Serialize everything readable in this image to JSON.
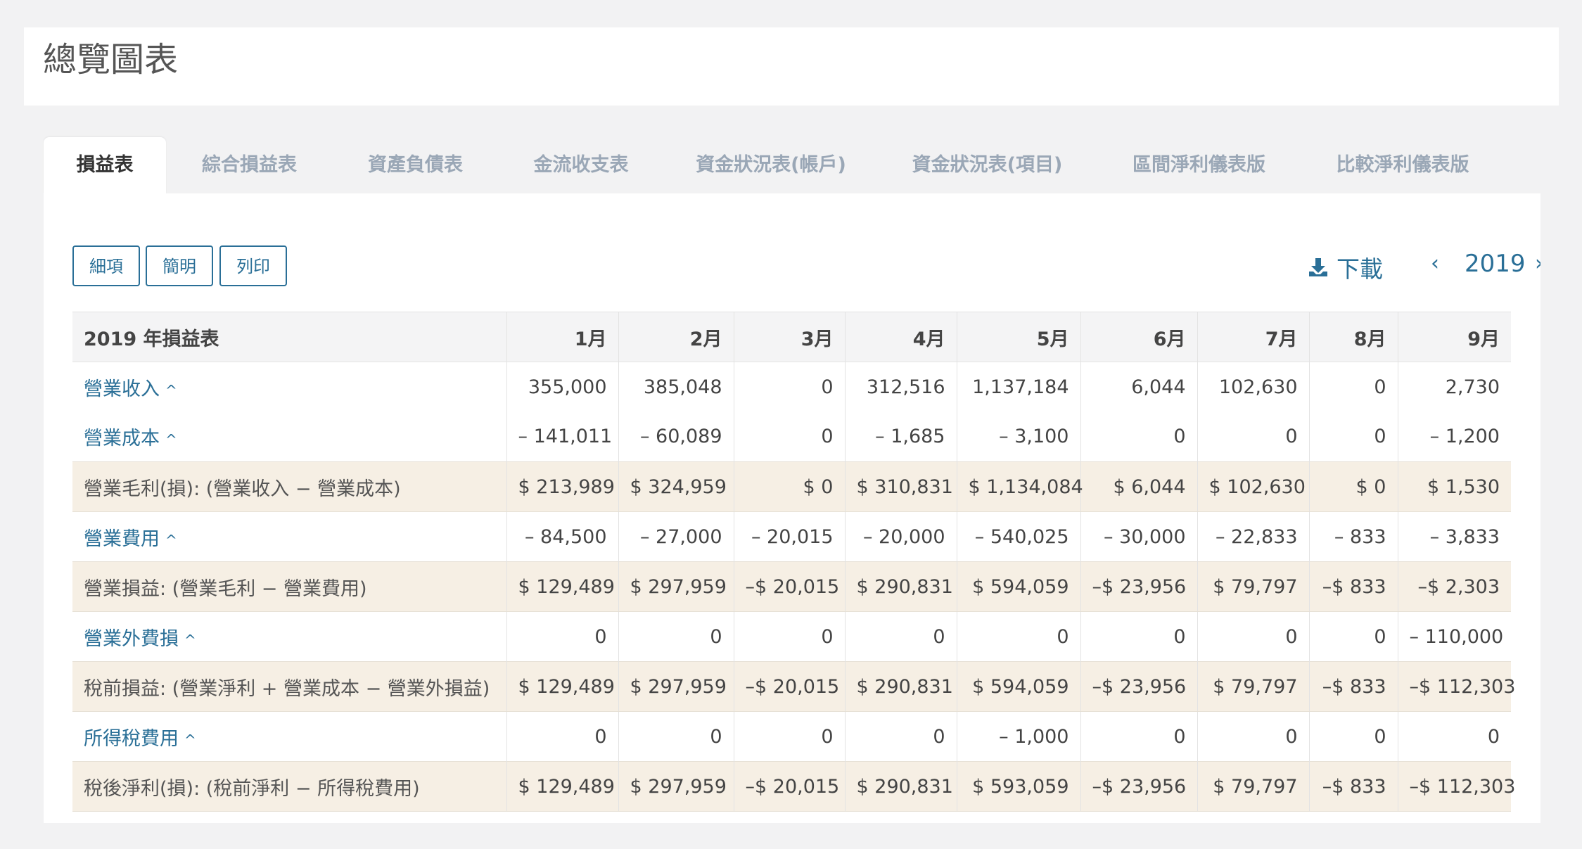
{
  "header": {
    "title": "總覽圖表"
  },
  "tabs": [
    {
      "label": "損益表",
      "active": true
    },
    {
      "label": "綜合損益表",
      "active": false
    },
    {
      "label": "資產負債表",
      "active": false
    },
    {
      "label": "金流收支表",
      "active": false
    },
    {
      "label": "資金狀況表(帳戶)",
      "active": false
    },
    {
      "label": "資金狀況表(項目)",
      "active": false
    },
    {
      "label": "區間淨利儀表版",
      "active": false
    },
    {
      "label": "比較淨利儀表版",
      "active": false
    }
  ],
  "toolbar": {
    "detail_label": "細項",
    "simple_label": "簡明",
    "print_label": "列印",
    "download_label": "下載",
    "download_icon": "download-icon",
    "year": "2019",
    "prev_glyph": "‹",
    "next_glyph": "›"
  },
  "colors": {
    "accent": "#2a6f97",
    "subtotal_bg": "#f6efe4",
    "header_bg": "#f4f4f5",
    "tab_inactive": "#9aa7b6"
  },
  "table": {
    "title": "2019 年損益表",
    "months": [
      "1月",
      "2月",
      "3月",
      "4月",
      "5月",
      "6月",
      "7月",
      "8月",
      "9月"
    ],
    "rows": [
      {
        "type": "section",
        "label": "營業收入",
        "chevron": "^",
        "values": [
          "355,000",
          "385,048",
          "0",
          "312,516",
          "1,137,184",
          "6,044",
          "102,630",
          "0",
          "2,730"
        ]
      },
      {
        "type": "section",
        "label": "營業成本",
        "chevron": "^",
        "values": [
          "– 141,011",
          "– 60,089",
          "0",
          "– 1,685",
          "– 3,100",
          "0",
          "0",
          "0",
          "– 1,200"
        ]
      },
      {
        "type": "subtotal",
        "label": "營業毛利(損): (營業收入 − 營業成本)",
        "values": [
          "$ 213,989",
          "$ 324,959",
          "$ 0",
          "$ 310,831",
          "$ 1,134,084",
          "$ 6,044",
          "$ 102,630",
          "$ 0",
          "$ 1,530"
        ]
      },
      {
        "type": "section",
        "label": "營業費用",
        "chevron": "^",
        "values": [
          "– 84,500",
          "– 27,000",
          "– 20,015",
          "– 20,000",
          "– 540,025",
          "– 30,000",
          "– 22,833",
          "– 833",
          "– 3,833"
        ]
      },
      {
        "type": "subtotal",
        "label": "營業損益: (營業毛利 − 營業費用)",
        "values": [
          "$ 129,489",
          "$ 297,959",
          "–$ 20,015",
          "$ 290,831",
          "$ 594,059",
          "–$ 23,956",
          "$ 79,797",
          "–$ 833",
          "–$ 2,303"
        ]
      },
      {
        "type": "section",
        "label": "營業外費損",
        "chevron": "^",
        "values": [
          "0",
          "0",
          "0",
          "0",
          "0",
          "0",
          "0",
          "0",
          "– 110,000"
        ]
      },
      {
        "type": "subtotal",
        "label": "稅前損益: (營業淨利 + 營業成本 − 營業外損益)",
        "values": [
          "$ 129,489",
          "$ 297,959",
          "–$ 20,015",
          "$ 290,831",
          "$ 594,059",
          "–$ 23,956",
          "$ 79,797",
          "–$ 833",
          "–$ 112,303"
        ]
      },
      {
        "type": "section",
        "label": "所得稅費用",
        "chevron": "^",
        "values": [
          "0",
          "0",
          "0",
          "0",
          "– 1,000",
          "0",
          "0",
          "0",
          "0"
        ]
      },
      {
        "type": "subtotal",
        "label": "稅後淨利(損): (稅前淨利 − 所得稅費用)",
        "values": [
          "$ 129,489",
          "$ 297,959",
          "–$ 20,015",
          "$ 290,831",
          "$ 593,059",
          "–$ 23,956",
          "$ 79,797",
          "–$ 833",
          "–$ 112,303"
        ]
      }
    ]
  }
}
